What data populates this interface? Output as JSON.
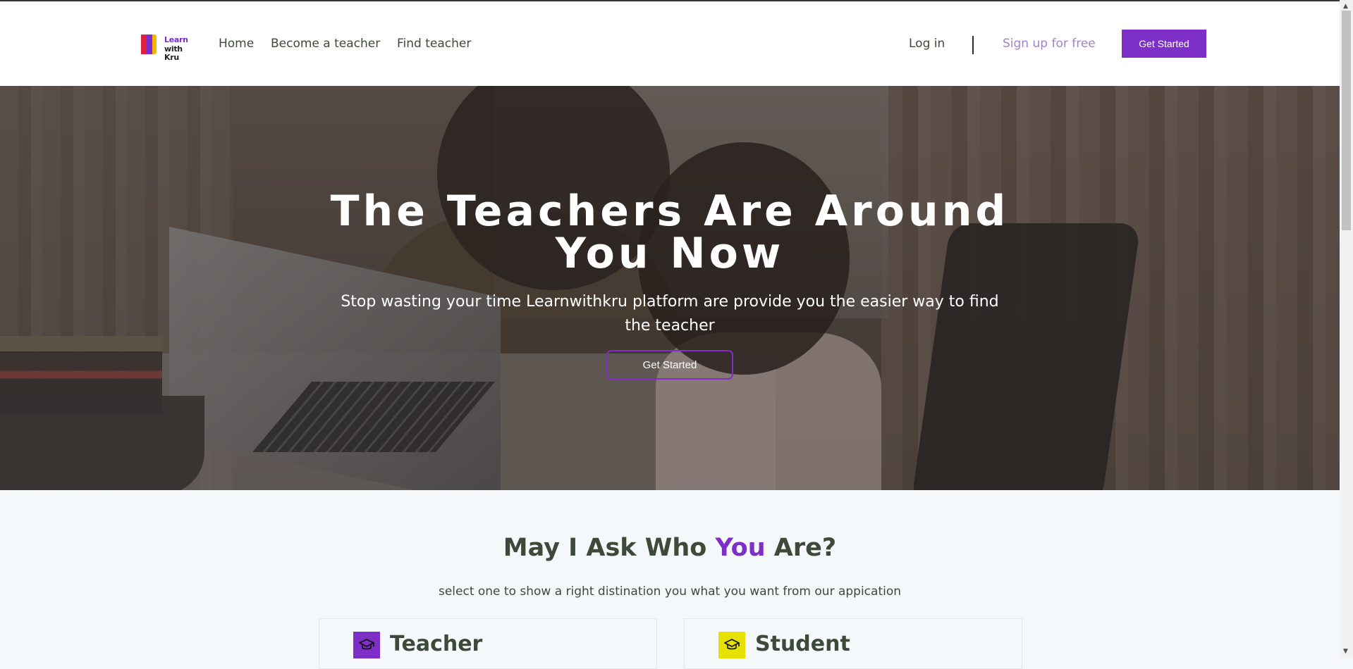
{
  "navbar": {
    "logo": {
      "line1": "Learn",
      "line2": "with Kru"
    },
    "links": {
      "home": "Home",
      "become_teacher": "Become a teacher",
      "find_teacher": "Find teacher"
    },
    "login": "Log in",
    "signup": "Sign up for free",
    "cta": "Get Started"
  },
  "hero": {
    "title": "The Teachers Are Around You Now",
    "subtitle": "Stop wasting your time Learnwithkru platform are provide you the easier way to find the teacher",
    "cta": "Get Started"
  },
  "section": {
    "title_start": "May I Ask Who ",
    "title_highlight": "You",
    "title_end": " Are?",
    "subtitle": "select one to show a right distination you what you want from our appication"
  },
  "cards": {
    "teacher": {
      "label": "Teacher",
      "icon": "graduation-cap-icon"
    },
    "student": {
      "label": "Student",
      "icon": "graduation-cap-icon"
    }
  },
  "colors": {
    "accent": "#7d2fc7",
    "student_icon_bg": "#e8e000",
    "text": "#3d4a3a",
    "signup": "#9d86c4"
  }
}
